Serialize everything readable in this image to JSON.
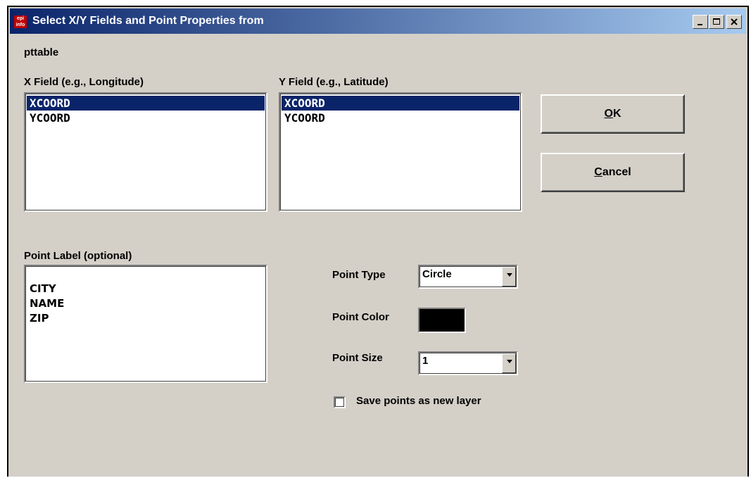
{
  "window": {
    "title": "Select X/Y Fields and Point Properties from",
    "app_icon_text": "epi info"
  },
  "table_name": "pttable",
  "x_field": {
    "label": "X Field (e.g., Longitude)",
    "items": [
      "XCOORD",
      "YCOORD"
    ],
    "selected": "XCOORD"
  },
  "y_field": {
    "label": "Y Field (e.g., Latitude)",
    "items": [
      "XCOORD",
      "YCOORD"
    ],
    "selected": "XCOORD"
  },
  "point_label": {
    "label": "Point Label (optional)",
    "items": [
      "CITY",
      "NAME",
      "ZIP"
    ]
  },
  "buttons": {
    "ok_accel": "O",
    "ok_rest": "K",
    "cancel_accel": "C",
    "cancel_rest": "ancel"
  },
  "point_type": {
    "label": "Point Type",
    "value": "Circle"
  },
  "point_color": {
    "label": "Point Color",
    "color": "#000000"
  },
  "point_size": {
    "label": "Point Size",
    "value": "1"
  },
  "save_layer": {
    "label": "Save points as new layer",
    "checked": false
  },
  "colors": {
    "title_start": "#0a246a",
    "title_end": "#a6caf0",
    "dialog_bg": "#d4d0c8",
    "selection": "#0a246a"
  }
}
